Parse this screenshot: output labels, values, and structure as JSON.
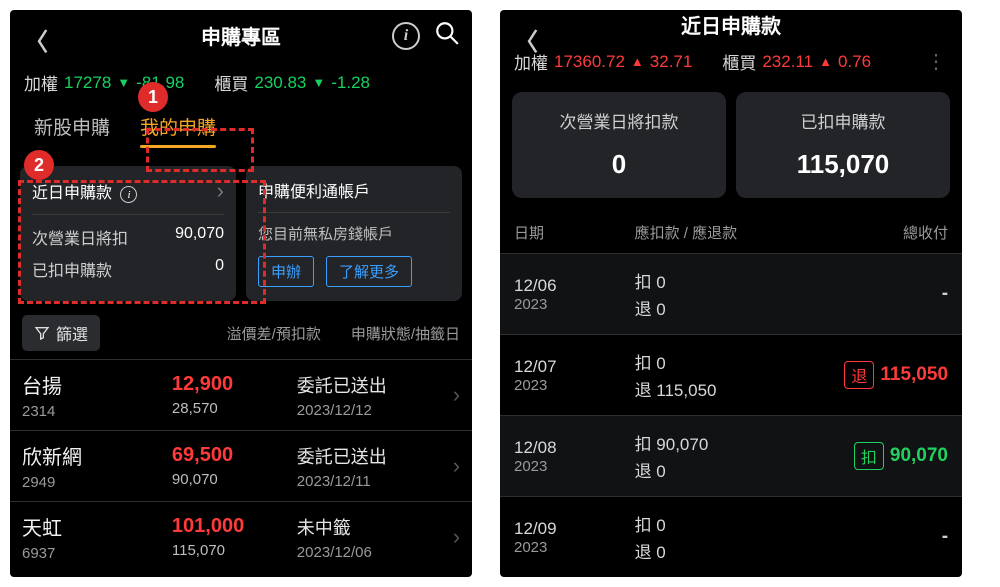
{
  "left": {
    "title": "申購專區",
    "ticker": {
      "label1": "加權",
      "val1": "17278",
      "chg1": "-81.98",
      "label2": "櫃買",
      "val2": "230.83",
      "chg2": "-1.28"
    },
    "tabs": {
      "t1": "新股申購",
      "t2": "我的申購"
    },
    "cardA": {
      "title": "近日申購款",
      "k1": "次營業日將扣",
      "v1": "90,070",
      "k2": "已扣申購款",
      "v2": "0"
    },
    "cardB": {
      "title": "申購便利通帳戶",
      "msg": "您目前無私房錢帳戶",
      "btn1": "申辦",
      "btn2": "了解更多"
    },
    "filter": {
      "btn": "篩選",
      "col1": "溢價差/預扣款",
      "col2": "申購狀態/抽籤日"
    },
    "rows": [
      {
        "name": "台揚",
        "code": "2314",
        "price": "12,900",
        "sub": "28,570",
        "status": "委託已送出",
        "date": "2023/12/12"
      },
      {
        "name": "欣新網",
        "code": "2949",
        "price": "69,500",
        "sub": "90,070",
        "status": "委託已送出",
        "date": "2023/12/11"
      },
      {
        "name": "天虹",
        "code": "6937",
        "price": "101,000",
        "sub": "115,070",
        "status": "未中籤",
        "date": "2023/12/06"
      }
    ],
    "badge1": "1",
    "badge2": "2"
  },
  "right": {
    "title": "近日申購款",
    "ticker": {
      "label1": "加權",
      "val1": "17360.72",
      "chg1": "32.71",
      "label2": "櫃買",
      "val2": "232.11",
      "chg2": "0.76"
    },
    "cards": {
      "lbl1": "次營業日將扣款",
      "val1": "0",
      "lbl2": "已扣申購款",
      "val2": "115,070"
    },
    "tbl_hdr": {
      "h1": "日期",
      "h2": "應扣款 / 應退款",
      "h3": "總收付"
    },
    "rows": [
      {
        "md": "12/06",
        "y": "2023",
        "deduct": "扣 0",
        "refund": "退 0",
        "badge": "",
        "amt": "-",
        "cls": "dash"
      },
      {
        "md": "12/07",
        "y": "2023",
        "deduct": "扣 0",
        "refund": "退 115,050",
        "badge": "退",
        "amt": "115,050",
        "cls": "red"
      },
      {
        "md": "12/08",
        "y": "2023",
        "deduct": "扣 90,070",
        "refund": "退 0",
        "badge": "扣",
        "amt": "90,070",
        "cls": "green"
      },
      {
        "md": "12/09",
        "y": "2023",
        "deduct": "扣 0",
        "refund": "退 0",
        "badge": "",
        "amt": "-",
        "cls": "dash"
      }
    ]
  }
}
